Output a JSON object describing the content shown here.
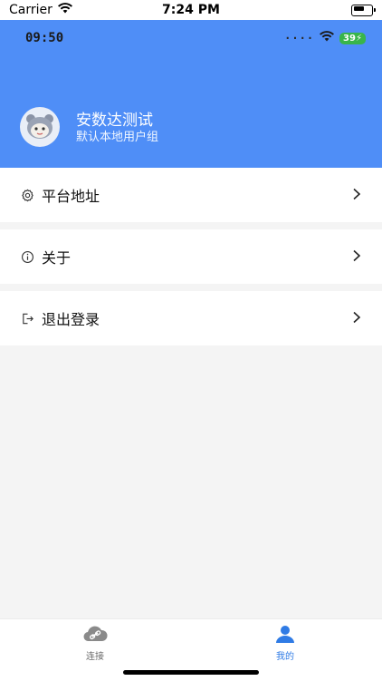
{
  "ios_status": {
    "carrier": "Carrier",
    "time": "7:24 PM"
  },
  "app_status": {
    "time": "09:50",
    "battery": "39"
  },
  "profile": {
    "name": "安数达测试",
    "group": "默认本地用户组"
  },
  "menu": [
    {
      "label": "平台地址",
      "icon": "settings-icon"
    },
    {
      "label": "关于",
      "icon": "info-icon"
    },
    {
      "label": "退出登录",
      "icon": "logout-icon"
    }
  ],
  "tabs": [
    {
      "label": "连接",
      "icon": "cloud-link-icon",
      "active": false
    },
    {
      "label": "我的",
      "icon": "user-icon",
      "active": true
    }
  ],
  "colors": {
    "primary": "#4f8ef7",
    "active_tab": "#2f7be5",
    "inactive_tab": "#6b6b6b"
  }
}
